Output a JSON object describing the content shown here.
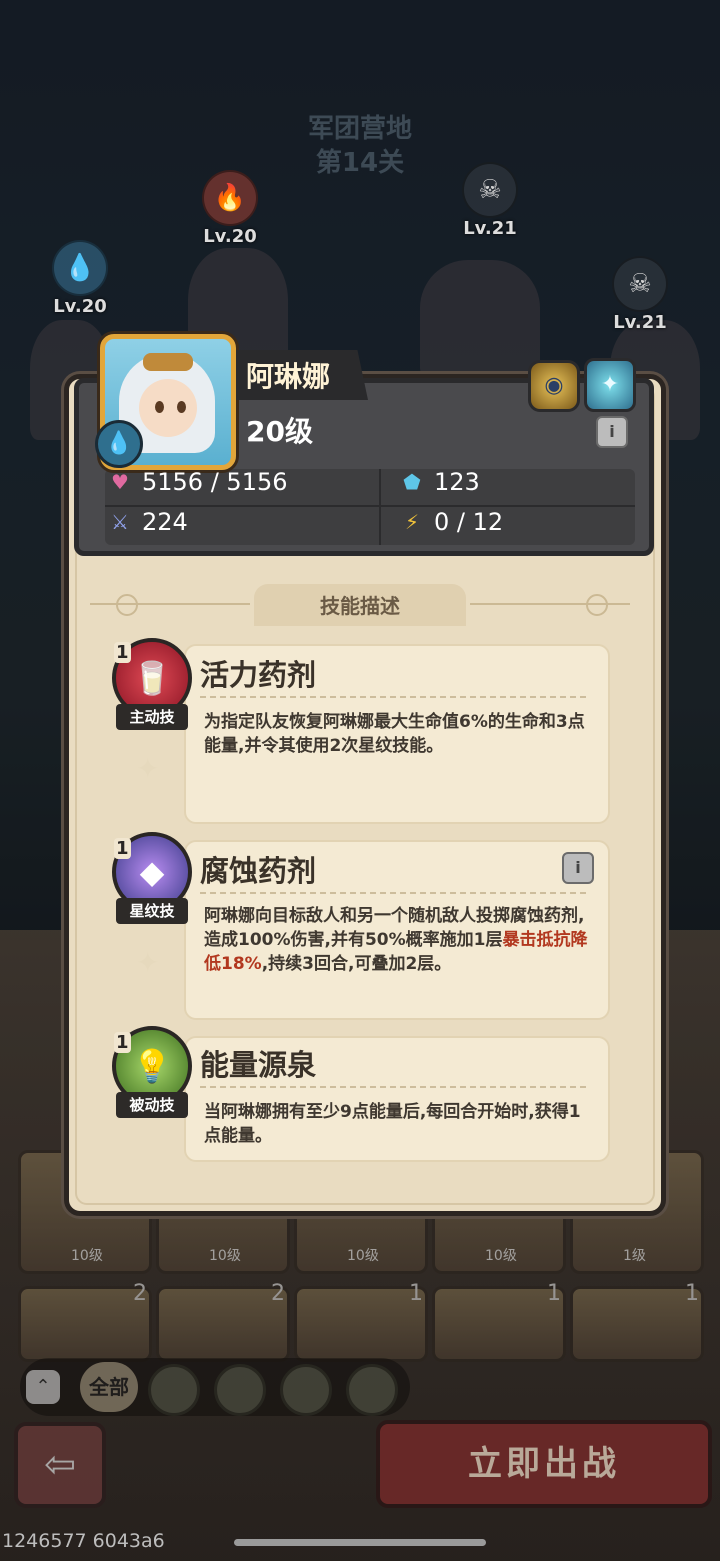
{
  "stage": {
    "line1": "军团营地",
    "line2": "第14关"
  },
  "enemies": [
    {
      "level": "Lv.20",
      "icon": "water-element-icon"
    },
    {
      "level": "Lv.20",
      "icon": "fire-element-icon"
    },
    {
      "level": "Lv.21",
      "icon": "skull-icon"
    },
    {
      "level": "Lv.21",
      "icon": "skull-icon"
    }
  ],
  "hero": {
    "name": "阿琳娜",
    "level": "20级",
    "stats": {
      "hp": "5156 / 5156",
      "defense": "123",
      "attack": "224",
      "energy": "0 / 12"
    }
  },
  "section_title": "技能描述",
  "skills": [
    {
      "rank": "1",
      "type": "主动技",
      "name": "活力药剂",
      "desc": "为指定队友恢复阿琳娜最大生命值6%的生命和3点能量,并令其使用2次星纹技能。",
      "icon": "horn-potion-icon",
      "color": "#c0283a"
    },
    {
      "rank": "1",
      "type": "星纹技",
      "name": "腐蚀药剂",
      "desc_plain": "阿琳娜向目标敌人和另一个随机敌人投掷腐蚀药剂,造成100%伤害,并有50%概率施加1层",
      "desc_highlight": "暴击抵抗降低18%",
      "desc_tail": ",持续3回合,可叠加2层。",
      "icon": "crystal-icon",
      "color": "#5a6fb8",
      "highlight_color": "#b2381f"
    },
    {
      "rank": "1",
      "type": "被动技",
      "name": "能量源泉",
      "desc": "当阿琳娜拥有至少9点能量后,每回合开始时,获得1点能量。",
      "icon": "lightbulb-icon",
      "color": "#5a8a2e"
    }
  ],
  "hero_grid": [
    {
      "level": "10级"
    },
    {
      "level": "10级"
    },
    {
      "level": "10级"
    },
    {
      "level": "10级"
    },
    {
      "level": "1级"
    }
  ],
  "hero_grid_row2_stars": [
    "2",
    "2",
    "1",
    "1",
    "1"
  ],
  "filter": {
    "all_label": "全部"
  },
  "actions": {
    "battle_label": "立即出战"
  },
  "footer": {
    "build_id": "1246577 6043a6"
  }
}
